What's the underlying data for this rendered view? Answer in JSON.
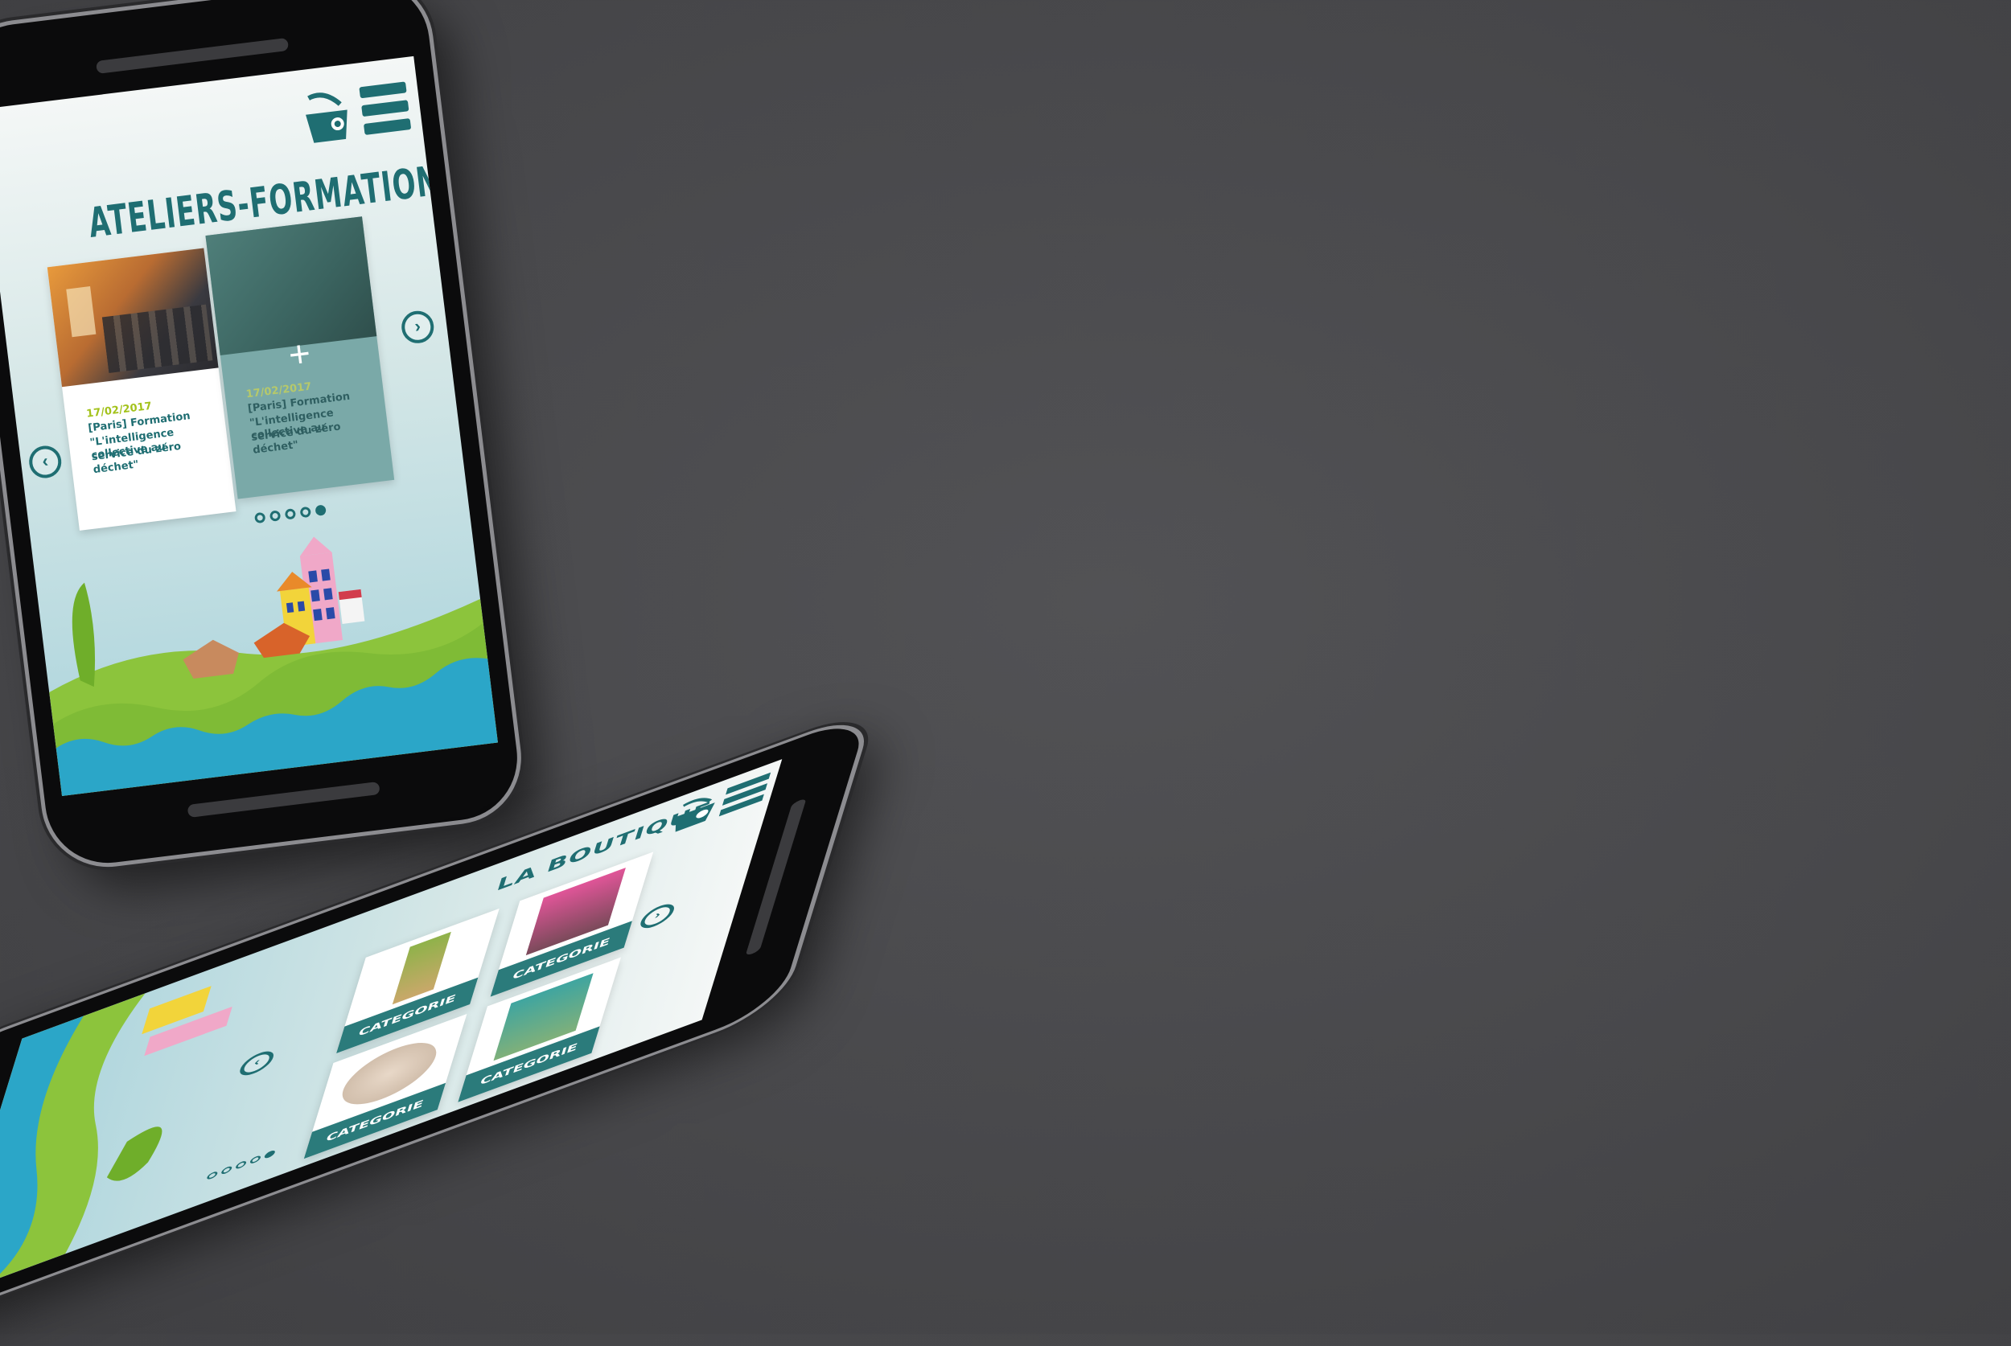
{
  "colors": {
    "teal": "#1f6e72",
    "teal_card": "#2b7b7b",
    "green": "#8cc43c",
    "date_green": "#a3c21b",
    "water": "#2ba6c8",
    "background": "#4a4a4d"
  },
  "header": {
    "cart_icon": "basket-icon",
    "menu_icon": "hamburger-menu-icon"
  },
  "ateliers": {
    "title": "ATELIERS-FORMATIONS",
    "events": [
      {
        "date": "17/02/2017",
        "text_line1": "[Paris] Formation",
        "text_line2": "\"L'intelligence collective au",
        "text_line3": "service du zéro déchet\""
      },
      {
        "date": "17/02/2017",
        "text_line1": "[Paris] Formation",
        "text_line2": "\"L'intelligence collective au",
        "text_line3": "service du zéro déchet\""
      }
    ],
    "pagination": {
      "total": 5,
      "active": 5
    }
  },
  "boutique": {
    "title": "LA BOUTIQUE",
    "categories": [
      {
        "label": "CATEGORIE"
      },
      {
        "label": "CATEGORIE"
      },
      {
        "label": "CATEGORIE"
      },
      {
        "label": "CATEGORIE"
      }
    ],
    "pagination": {
      "total": 5,
      "active": 5
    }
  }
}
